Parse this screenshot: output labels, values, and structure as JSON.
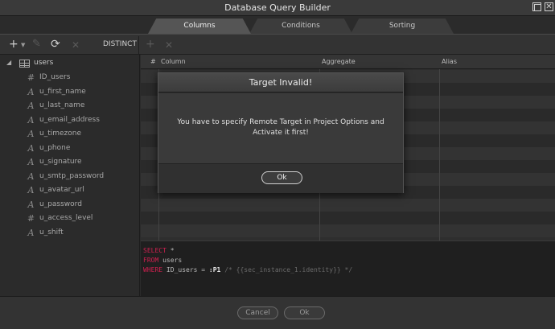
{
  "window": {
    "title": "Database Query Builder"
  },
  "tabs": [
    {
      "label": "Columns",
      "active": true
    },
    {
      "label": "Conditions",
      "active": false
    },
    {
      "label": "Sorting",
      "active": false
    }
  ],
  "toolbar": {
    "distinct_label": "DISTINCT"
  },
  "tree": {
    "table": "users",
    "fields": [
      {
        "name": "ID_users",
        "icon": "hash-icon"
      },
      {
        "name": "u_first_name",
        "icon": "text-icon"
      },
      {
        "name": "u_last_name",
        "icon": "text-icon"
      },
      {
        "name": "u_email_address",
        "icon": "text-icon"
      },
      {
        "name": "u_timezone",
        "icon": "text-icon"
      },
      {
        "name": "u_phone",
        "icon": "text-icon"
      },
      {
        "name": "u_signature",
        "icon": "text-icon"
      },
      {
        "name": "u_smtp_password",
        "icon": "text-icon"
      },
      {
        "name": "u_avatar_url",
        "icon": "text-icon"
      },
      {
        "name": "u_password",
        "icon": "text-icon"
      },
      {
        "name": "u_access_level",
        "icon": "hash-icon"
      },
      {
        "name": "u_shift",
        "icon": "text-icon"
      }
    ]
  },
  "grid": {
    "columns": [
      "#",
      "Column",
      "Aggregate",
      "Alias"
    ]
  },
  "sql": {
    "select_kw": "SELECT",
    "select_val": "*",
    "from_kw": "FROM",
    "from_val": "users",
    "where_kw": "WHERE",
    "where_field": "ID_users =",
    "where_param": ":P1",
    "where_comment": "/* {{sec_instance_1.identity}} */"
  },
  "footer": {
    "cancel_label": "Cancel",
    "ok_label": "Ok"
  },
  "dialog": {
    "title": "Target Invalid!",
    "message": "You have to specify Remote Target in Project Options and Activate it first!",
    "ok_label": "Ok"
  },
  "colors": {
    "keyword": "#d02050",
    "background": "#2b2b2b",
    "dialog_body": "#3a3a3a"
  }
}
